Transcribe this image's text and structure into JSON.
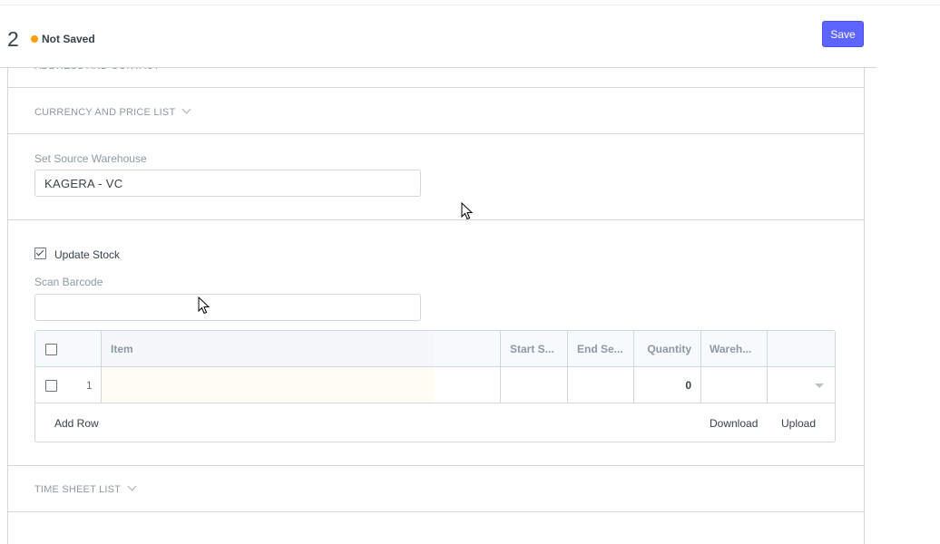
{
  "header": {
    "doc_title": "2",
    "status": "Not Saved",
    "save_label": "Save"
  },
  "sections": {
    "address_contact": "ADDRESS AND CONTACT",
    "currency_price_list": "CURRENCY AND PRICE LIST",
    "time_sheet_list": "TIME SHEET LIST"
  },
  "fields": {
    "source_warehouse_label": "Set Source Warehouse",
    "source_warehouse_value": "KAGERA - VC",
    "update_stock_label": "Update Stock",
    "update_stock_checked": true,
    "scan_barcode_label": "Scan Barcode",
    "scan_barcode_value": ""
  },
  "items_table": {
    "columns": [
      "Item",
      "Start S...",
      "End Se...",
      "Quantity",
      "Wareh..."
    ],
    "rows": [
      {
        "idx": "1",
        "item": "",
        "start_serial": "",
        "end_serial": "",
        "quantity": "0",
        "warehouse": ""
      }
    ],
    "add_row_label": "Add Row",
    "download_label": "Download",
    "upload_label": "Upload"
  },
  "colors": {
    "primary": "#5e64ff",
    "not_saved_indicator": "#ffa00a",
    "border": "#d1d8dd",
    "muted_text": "#8d99a6"
  },
  "icons": [
    "chevron-down-icon",
    "checkbox-icon",
    "dropdown-caret-icon",
    "mouse-pointer-icon"
  ]
}
